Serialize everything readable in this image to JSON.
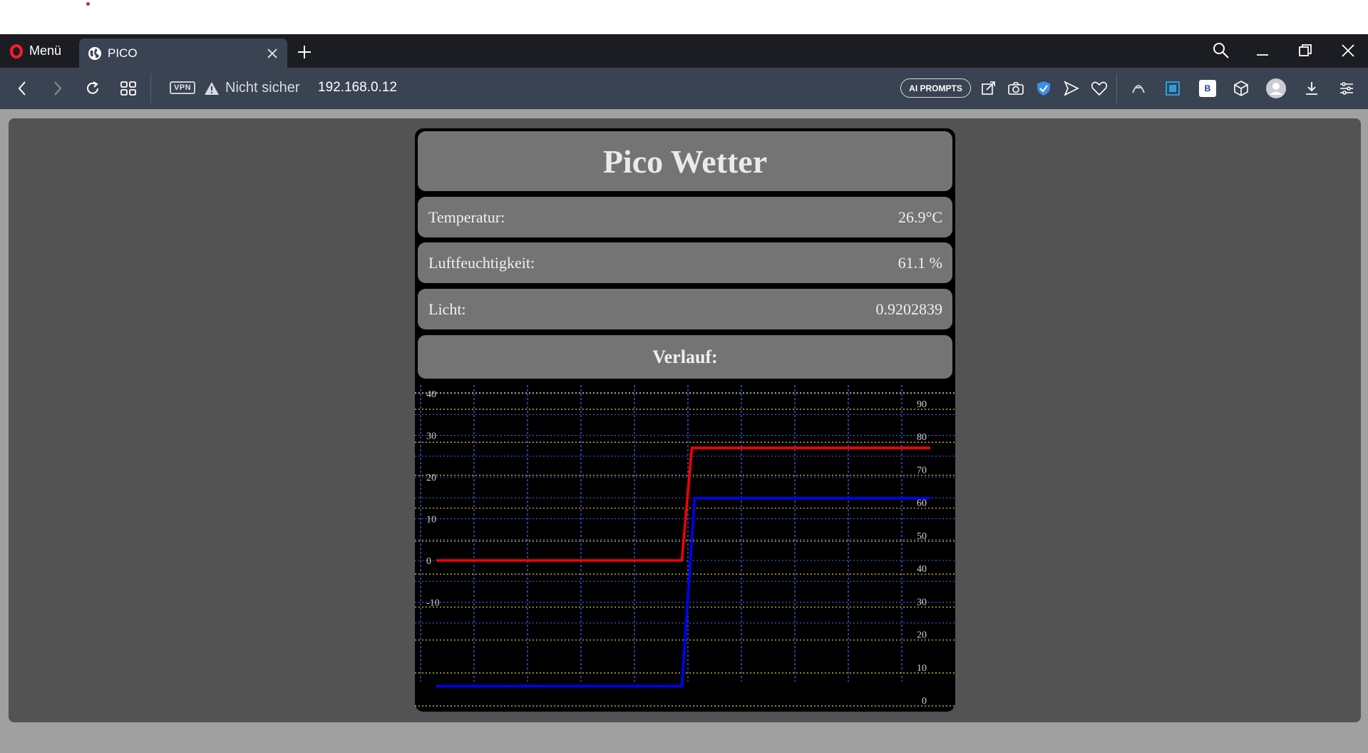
{
  "browser": {
    "menu_label": "Menü",
    "tab_title": "PICO",
    "vpn_label": "VPN",
    "security_text": "Nicht sicher",
    "url": "192.168.0.12",
    "ai_prompts_label": "AI PROMPTS",
    "sidebar_badge": "B",
    "accent_color": "#ff1b2d"
  },
  "page": {
    "title": "Pico Wetter",
    "rows": [
      {
        "label": "Temperatur:",
        "value": "26.9°C"
      },
      {
        "label": "Luftfeuchtigkeit:",
        "value": "61.1 %"
      },
      {
        "label": "Licht:",
        "value": "0.9202839"
      }
    ],
    "history_label": "Verlauf:"
  },
  "chart_data": {
    "type": "line",
    "left_axis": {
      "ticks": [
        40,
        30,
        20,
        10,
        0,
        -10
      ],
      "range": [
        -10,
        40
      ]
    },
    "right_axis": {
      "ticks": [
        90,
        80,
        70,
        60,
        50,
        40,
        30,
        20,
        10,
        0
      ],
      "range": [
        0,
        97
      ]
    },
    "grid": true,
    "series": [
      {
        "axis": "left",
        "color": "#ff0000",
        "values": [
          0,
          0,
          0,
          0,
          0,
          0,
          27,
          27,
          27,
          27,
          27,
          27
        ]
      },
      {
        "axis": "right",
        "color": "#0000ff",
        "values": [
          6,
          6,
          6,
          6,
          6,
          6,
          63,
          63,
          63,
          63,
          63,
          63
        ]
      }
    ]
  }
}
